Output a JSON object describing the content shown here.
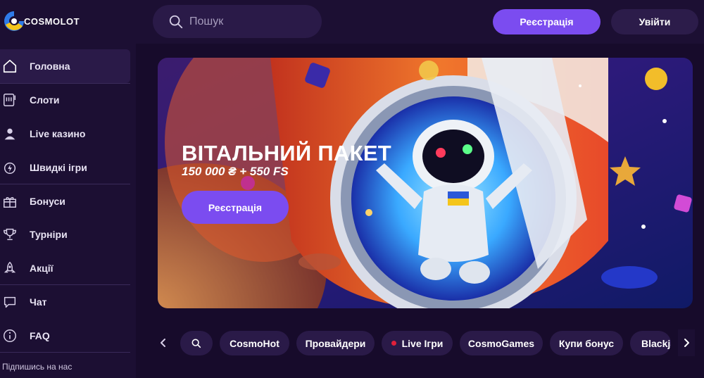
{
  "brand": {
    "name": "COSMOLOT"
  },
  "header": {
    "search_placeholder": "Пошук",
    "register_label": "Реєстрація",
    "login_label": "Увійти"
  },
  "sidebar": {
    "items": [
      {
        "label": "Головна",
        "icon": "home-icon",
        "active": true
      },
      {
        "label": "Слоти",
        "icon": "slot-machine-icon"
      },
      {
        "label": "Live казино",
        "icon": "dealer-icon"
      },
      {
        "label": "Швидкі ігри",
        "icon": "lightning-icon"
      },
      {
        "label": "Бонуси",
        "icon": "gift-icon"
      },
      {
        "label": "Турніри",
        "icon": "trophy-icon"
      },
      {
        "label": "Акції",
        "icon": "rocket-icon"
      },
      {
        "label": "Чат",
        "icon": "chat-bubble-icon"
      },
      {
        "label": "FAQ",
        "icon": "info-icon"
      }
    ],
    "follow_label": "Підпишись на нас"
  },
  "banner": {
    "title": "ВІТАЛЬНИЙ ПАКЕТ",
    "subtitle": "150 000 ₴ + 550 FS",
    "cta_label": "Реєстрація"
  },
  "categories": {
    "items": [
      {
        "label": "CosmoHot"
      },
      {
        "label": "Провайдери"
      },
      {
        "label": "Live Ігри",
        "live_dot": true
      },
      {
        "label": "CosmoGames"
      },
      {
        "label": "Купи бонус"
      },
      {
        "label": "Blackjack"
      }
    ]
  },
  "colors": {
    "background": "#1c0f33",
    "accent": "#7b4cf0",
    "chip": "#2a1a48",
    "live_dot": "#e0203a"
  }
}
